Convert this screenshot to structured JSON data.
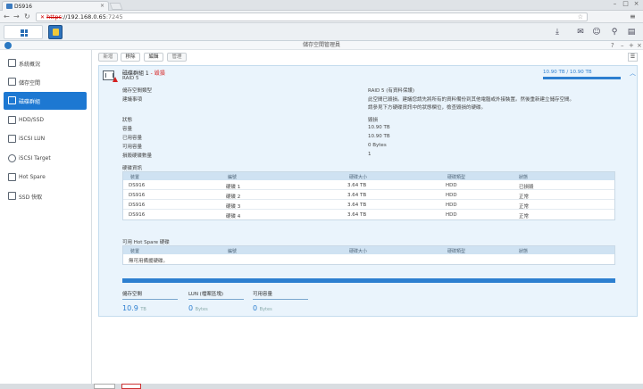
{
  "browser": {
    "tab_title": "DS916",
    "url_scheme": "https",
    "url_host": "://192.168.0.65",
    "url_rest": ":7245"
  },
  "window": {
    "title": "儲存空間管理員"
  },
  "sidebar": {
    "items": [
      {
        "label": "系統概況",
        "icon": "system-icon"
      },
      {
        "label": "儲存空間",
        "icon": "volume-icon"
      },
      {
        "label": "磁碟群組",
        "icon": "disk-group-icon"
      },
      {
        "label": "HDD/SSD",
        "icon": "hdd-icon"
      },
      {
        "label": "iSCSI LUN",
        "icon": "iscsi-lun-icon"
      },
      {
        "label": "iSCSI Target",
        "icon": "iscsi-target-icon"
      },
      {
        "label": "Hot Spare",
        "icon": "hot-spare-icon"
      },
      {
        "label": "SSD 快取",
        "icon": "ssd-cache-icon"
      }
    ],
    "selected": "磁碟群組"
  },
  "toolbar": {
    "create": "新增",
    "remove": "移除",
    "edit": "編輯",
    "manage": "管理"
  },
  "group": {
    "name": "磁碟群組 1",
    "status_suffix": "- 毀損",
    "raid": "RAID 5",
    "capacity_text": "10.90 TB / 10.90 TB",
    "capacity_fraction": 1.0,
    "rows": [
      {
        "label": "儲存空間類型",
        "value": "RAID 5 (有資料保護)",
        "style": "normal"
      },
      {
        "label": "建議事項",
        "value": "此空間已毀損。建議您請先將所有的資料備份到其他電腦或外接裝置。然後重新建立儲存空間。",
        "style": "error"
      },
      {
        "label": "",
        "value": "請參見下方硬碟資訊中的狀態欄位，檢查毀損的硬碟。",
        "style": "error"
      },
      {
        "label": "狀態",
        "value": "毀損",
        "style": "error"
      },
      {
        "label": "容量",
        "value": "10.90 TB",
        "style": "normal"
      },
      {
        "label": "已用容量",
        "value": "10.90 TB",
        "style": "normal"
      },
      {
        "label": "可用容量",
        "value": "0 Bytes",
        "style": "normal"
      },
      {
        "label": "損毀硬碟數量",
        "value": "1",
        "style": "error"
      }
    ],
    "disk_info_label": "硬碟資訊",
    "disk_table": {
      "headers": [
        "裝置",
        "編號",
        "硬碟大小",
        "硬碟類型",
        "狀態"
      ],
      "rows": [
        {
          "device": "DS916",
          "id": "硬碟 1",
          "size": "3.64 TB",
          "type": "HDD",
          "status": "已損毀",
          "ok": false
        },
        {
          "device": "DS916",
          "id": "硬碟 2",
          "size": "3.64 TB",
          "type": "HDD",
          "status": "正常",
          "ok": true
        },
        {
          "device": "DS916",
          "id": "硬碟 3",
          "size": "3.64 TB",
          "type": "HDD",
          "status": "正常",
          "ok": true
        },
        {
          "device": "DS916",
          "id": "硬碟 4",
          "size": "3.64 TB",
          "type": "HDD",
          "status": "正常",
          "ok": true
        }
      ]
    },
    "hotspare_label": "可用 Hot Spare 硬碟",
    "hotspare_table": {
      "headers": [
        "裝置",
        "編號",
        "硬碟大小",
        "硬碟類型",
        "狀態"
      ],
      "empty": "無可用備援硬碟。"
    },
    "stats": [
      {
        "label": "儲存空間",
        "value": "10.9",
        "unit": "TB"
      },
      {
        "label": "LUN (檔案區塊)",
        "value": "0",
        "unit": "Bytes"
      },
      {
        "label": "可用容量",
        "value": "0",
        "unit": "Bytes"
      }
    ]
  },
  "colors": {
    "accent": "#1d78d2",
    "error": "#d62020",
    "ok": "#2e9d2e"
  }
}
